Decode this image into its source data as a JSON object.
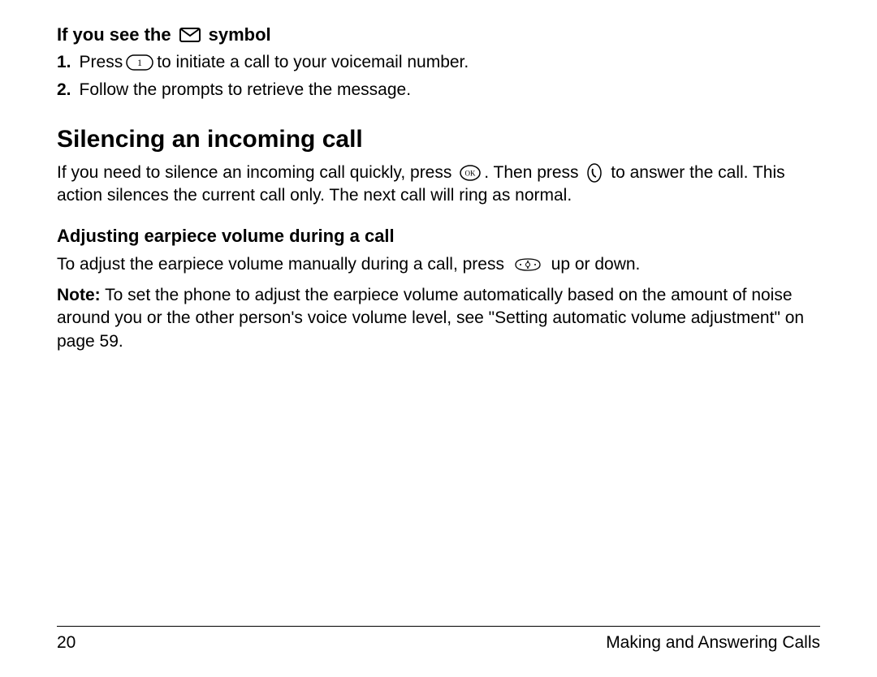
{
  "heading_envelope_prefix": "If you see the",
  "heading_envelope_suffix": "symbol",
  "step1_num": "1.",
  "step1_a": "Press",
  "step1_b": "to initiate a call to your voicemail number.",
  "step2_num": "2.",
  "step2": "Follow the prompts to retrieve the message.",
  "silencing_heading": "Silencing an incoming call",
  "silencing_a": "If you need to silence an incoming call quickly, press",
  "silencing_b": ". Then press",
  "silencing_c": "to answer the call. This action silences the current call only. The next call will ring as normal.",
  "adjusting_heading": "Adjusting earpiece volume during a call",
  "adjusting_a": "To adjust the earpiece volume manually during a call, press",
  "adjusting_b": "up or down.",
  "note_label": "Note:",
  "note_body": "To set the phone to adjust the earpiece volume automatically based on the amount of noise around you or the other person's voice volume level, see \"Setting automatic volume adjustment\" on page 59.",
  "page_number": "20",
  "footer_title": "Making and Answering Calls"
}
